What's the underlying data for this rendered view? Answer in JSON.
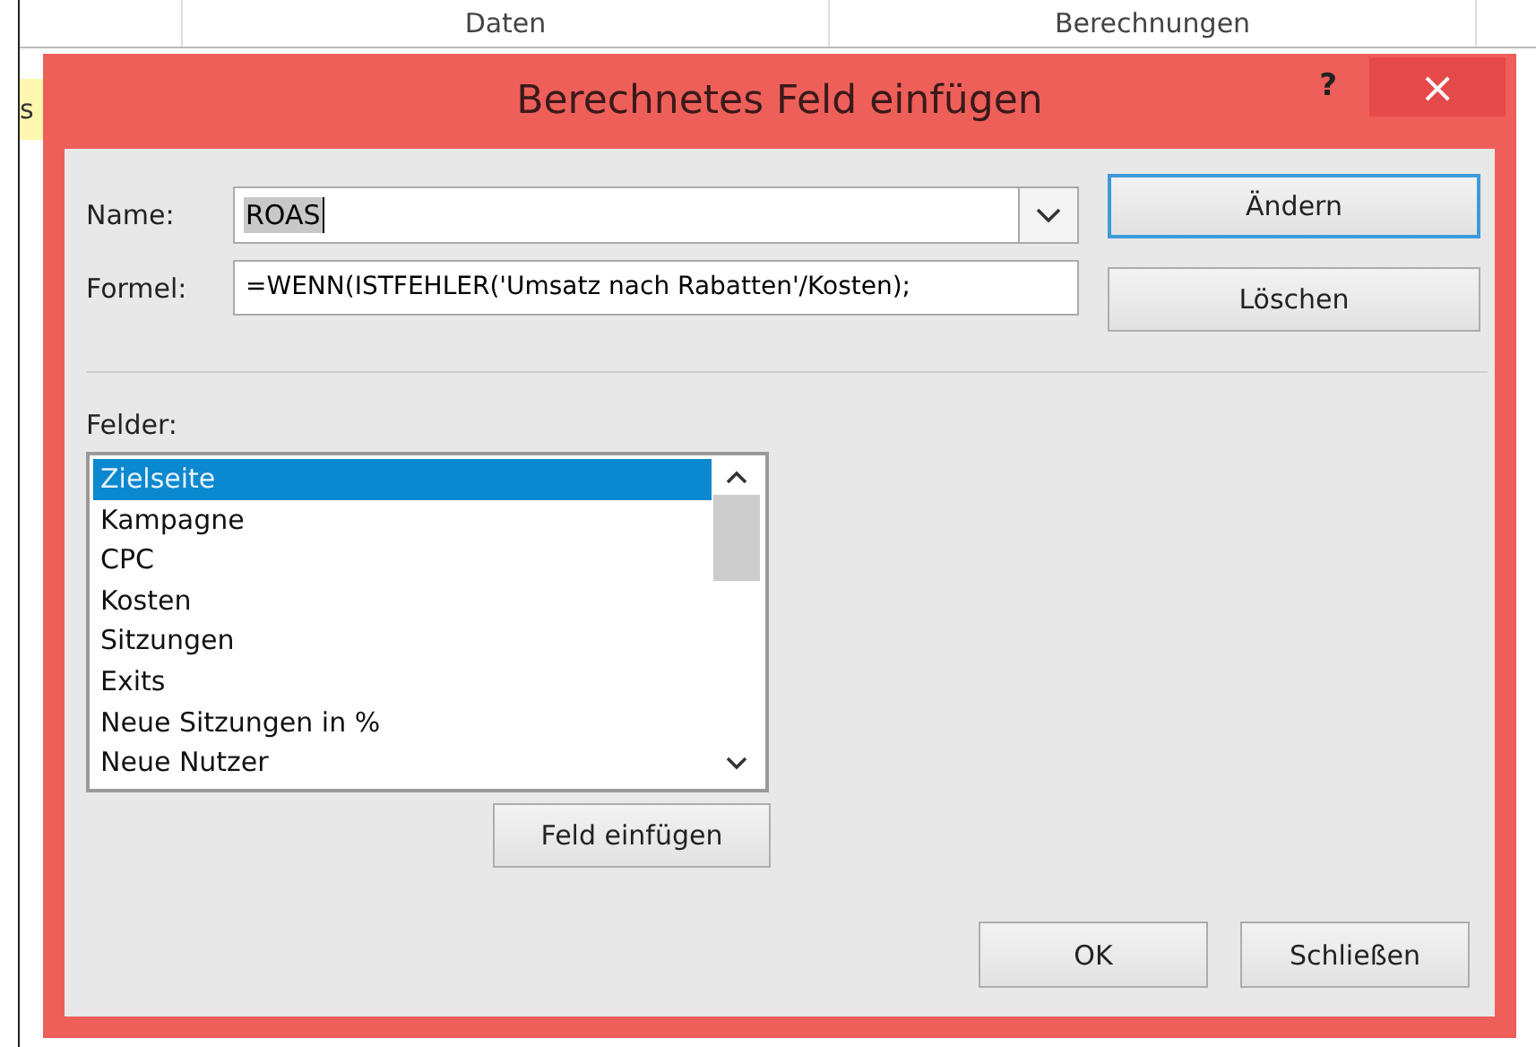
{
  "sheet": {
    "headers": [
      "Daten",
      "Berechnungen"
    ],
    "cell_text": "s"
  },
  "dialog": {
    "title": "Berechnetes Feld einfügen",
    "help": "?",
    "close": "×",
    "name_field": {
      "label": "Name:",
      "value": "ROAS"
    },
    "formula_field": {
      "label": "Formel:",
      "value": "=WENN(ISTFEHLER('Umsatz nach Rabatten'/Kosten);"
    },
    "side_buttons": [
      {
        "label": "Ändern",
        "focused": true
      },
      {
        "label": "Löschen",
        "focused": false
      }
    ],
    "fields_label": {
      "label": "Felder:"
    },
    "fields": [
      {
        "label": "Zielseite",
        "selected": true
      },
      {
        "label": "Kampagne",
        "selected": false
      },
      {
        "label": "CPC",
        "selected": false
      },
      {
        "label": "Kosten",
        "selected": false
      },
      {
        "label": "Sitzungen",
        "selected": false
      },
      {
        "label": "Exits",
        "selected": false
      },
      {
        "label": "Neue Sitzungen in %",
        "selected": false
      },
      {
        "label": "Neue Nutzer",
        "selected": false
      }
    ],
    "insert_button": {
      "label": "Feld einfügen"
    },
    "buttons": [
      "OK",
      "Schließen"
    ]
  }
}
